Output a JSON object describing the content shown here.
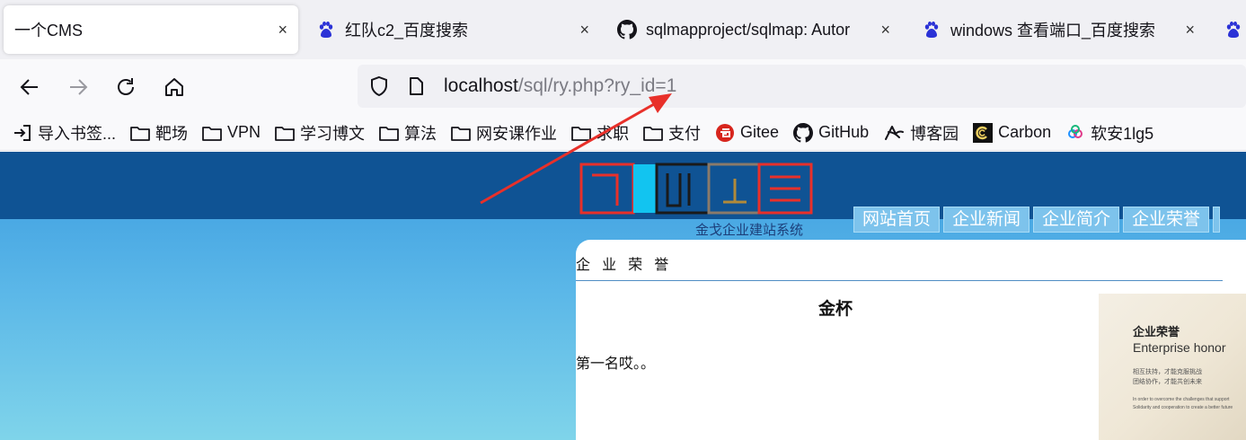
{
  "browser": {
    "tabs": [
      {
        "title": "一个CMS",
        "icon": "document-icon",
        "active": true
      },
      {
        "title": "红队c2_百度搜索",
        "icon": "baidu-paw-icon",
        "active": false
      },
      {
        "title": "sqlmapproject/sqlmap: Autor",
        "icon": "github-icon",
        "active": false
      },
      {
        "title": "windows 查看端口_百度搜索",
        "icon": "baidu-paw-icon",
        "active": false
      }
    ],
    "tab_close_glyph": "×",
    "url": {
      "host": "localhost",
      "path": "/sql/ry.php?ry_id=1"
    },
    "bookmarks": [
      {
        "label": "导入书签...",
        "icon": "import-icon"
      },
      {
        "label": "靶场",
        "icon": "folder-icon"
      },
      {
        "label": "VPN",
        "icon": "folder-icon"
      },
      {
        "label": "学习博文",
        "icon": "folder-icon"
      },
      {
        "label": "算法",
        "icon": "folder-icon"
      },
      {
        "label": "网安课作业",
        "icon": "folder-icon"
      },
      {
        "label": "求职",
        "icon": "folder-icon"
      },
      {
        "label": "支付",
        "icon": "folder-icon"
      },
      {
        "label": "Gitee",
        "icon": "gitee-icon"
      },
      {
        "label": "GitHub",
        "icon": "github-icon"
      },
      {
        "label": "博客园",
        "icon": "cnblogs-icon"
      },
      {
        "label": "Carbon",
        "icon": "carbon-icon"
      },
      {
        "label": "软安1lg5",
        "icon": "cloud-icon"
      }
    ]
  },
  "site": {
    "logo_subtitle": "金戈企业建站系统",
    "nav": [
      "网站首页",
      "企业新闻",
      "企业简介",
      "企业荣誉"
    ],
    "section_title": "企 业 荣 誉",
    "article_title": "金杯",
    "article_body": "第一名哎。。",
    "honor_image": {
      "title": "企业荣誉",
      "subtitle": "Enterprise honor",
      "cn_line1": "相互扶持，才能克服挑战",
      "cn_line2": "团结协作，才能共创未来",
      "en_line1": "In order to overcome the challenges that support",
      "en_line2": "Solidarity and cooperation to create a better future"
    }
  },
  "colors": {
    "accent_red": "#e8302a",
    "site_header": "#0f5394",
    "baidu_blue": "#2b32d6"
  }
}
